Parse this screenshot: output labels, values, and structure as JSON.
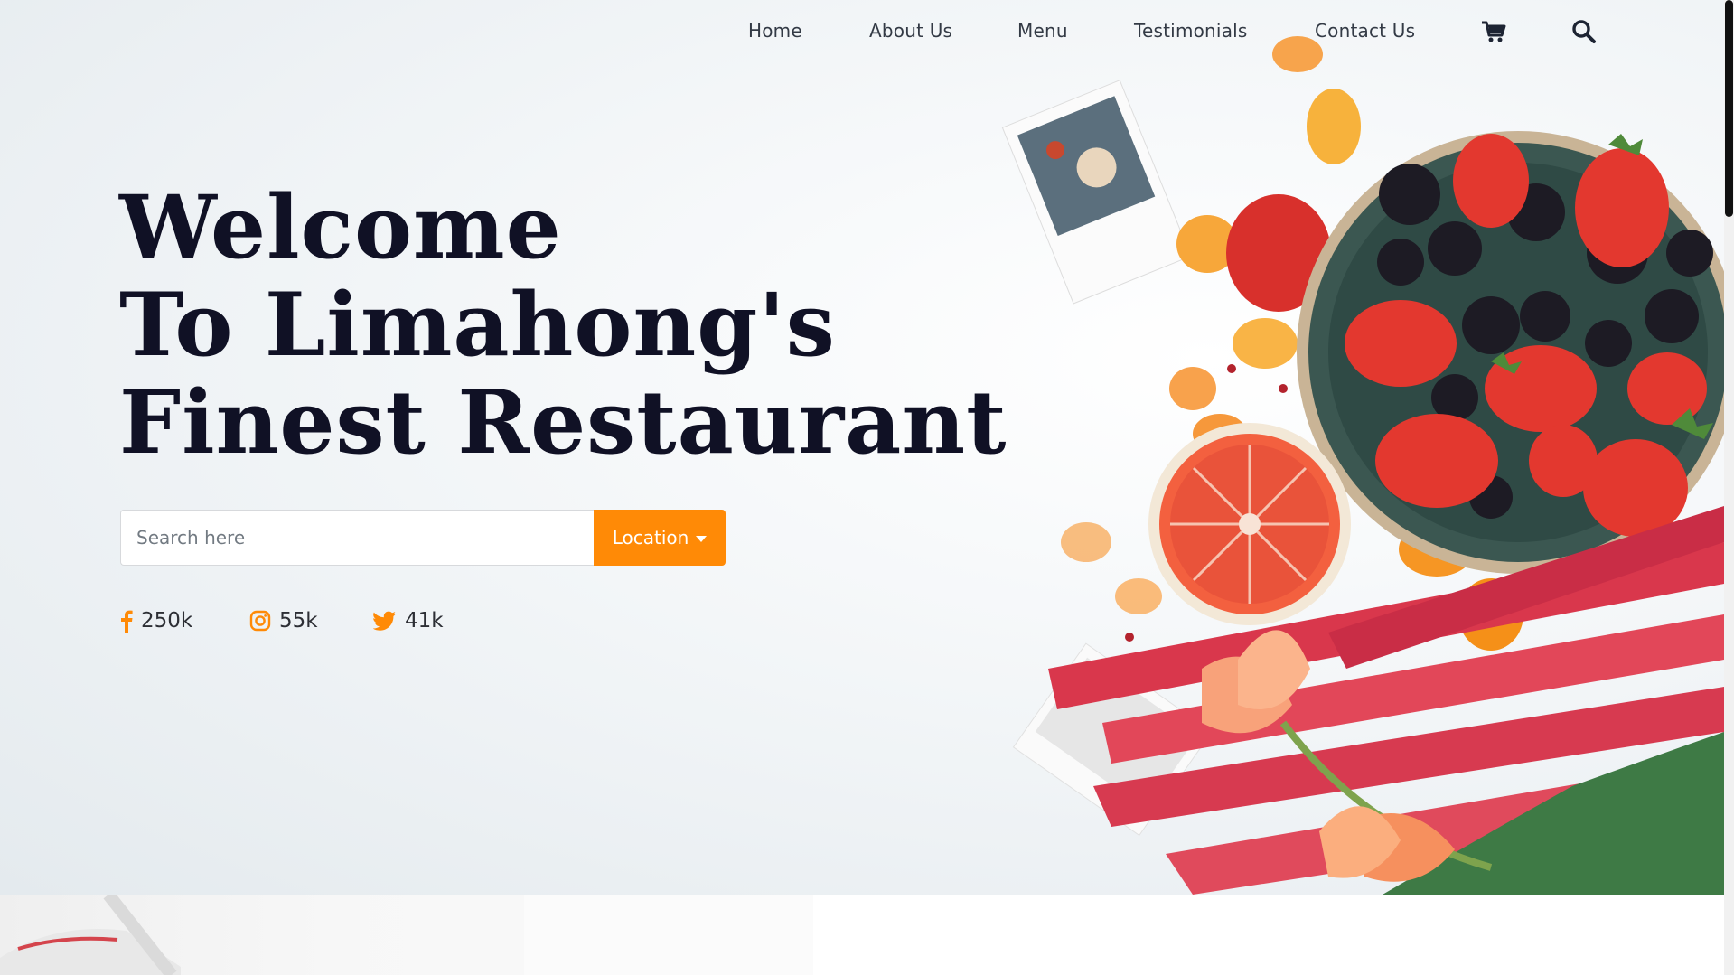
{
  "nav": {
    "items": [
      "Home",
      "About Us",
      "Menu",
      "Testimonials",
      "Contact Us"
    ],
    "cart_icon": "shopping-cart-icon",
    "search_icon": "search-icon"
  },
  "hero": {
    "headline": [
      "Welcome",
      "To Limahong's",
      "Finest Restaurant"
    ]
  },
  "search": {
    "placeholder": "Search here",
    "location_label": "Location"
  },
  "social": [
    {
      "icon": "facebook-icon",
      "count": "250k"
    },
    {
      "icon": "instagram-icon",
      "count": "55k"
    },
    {
      "icon": "twitter-icon",
      "count": "41k"
    }
  ],
  "colors": {
    "accent": "#ff8a06",
    "headline": "#101125",
    "nav_text": "#333a45"
  }
}
